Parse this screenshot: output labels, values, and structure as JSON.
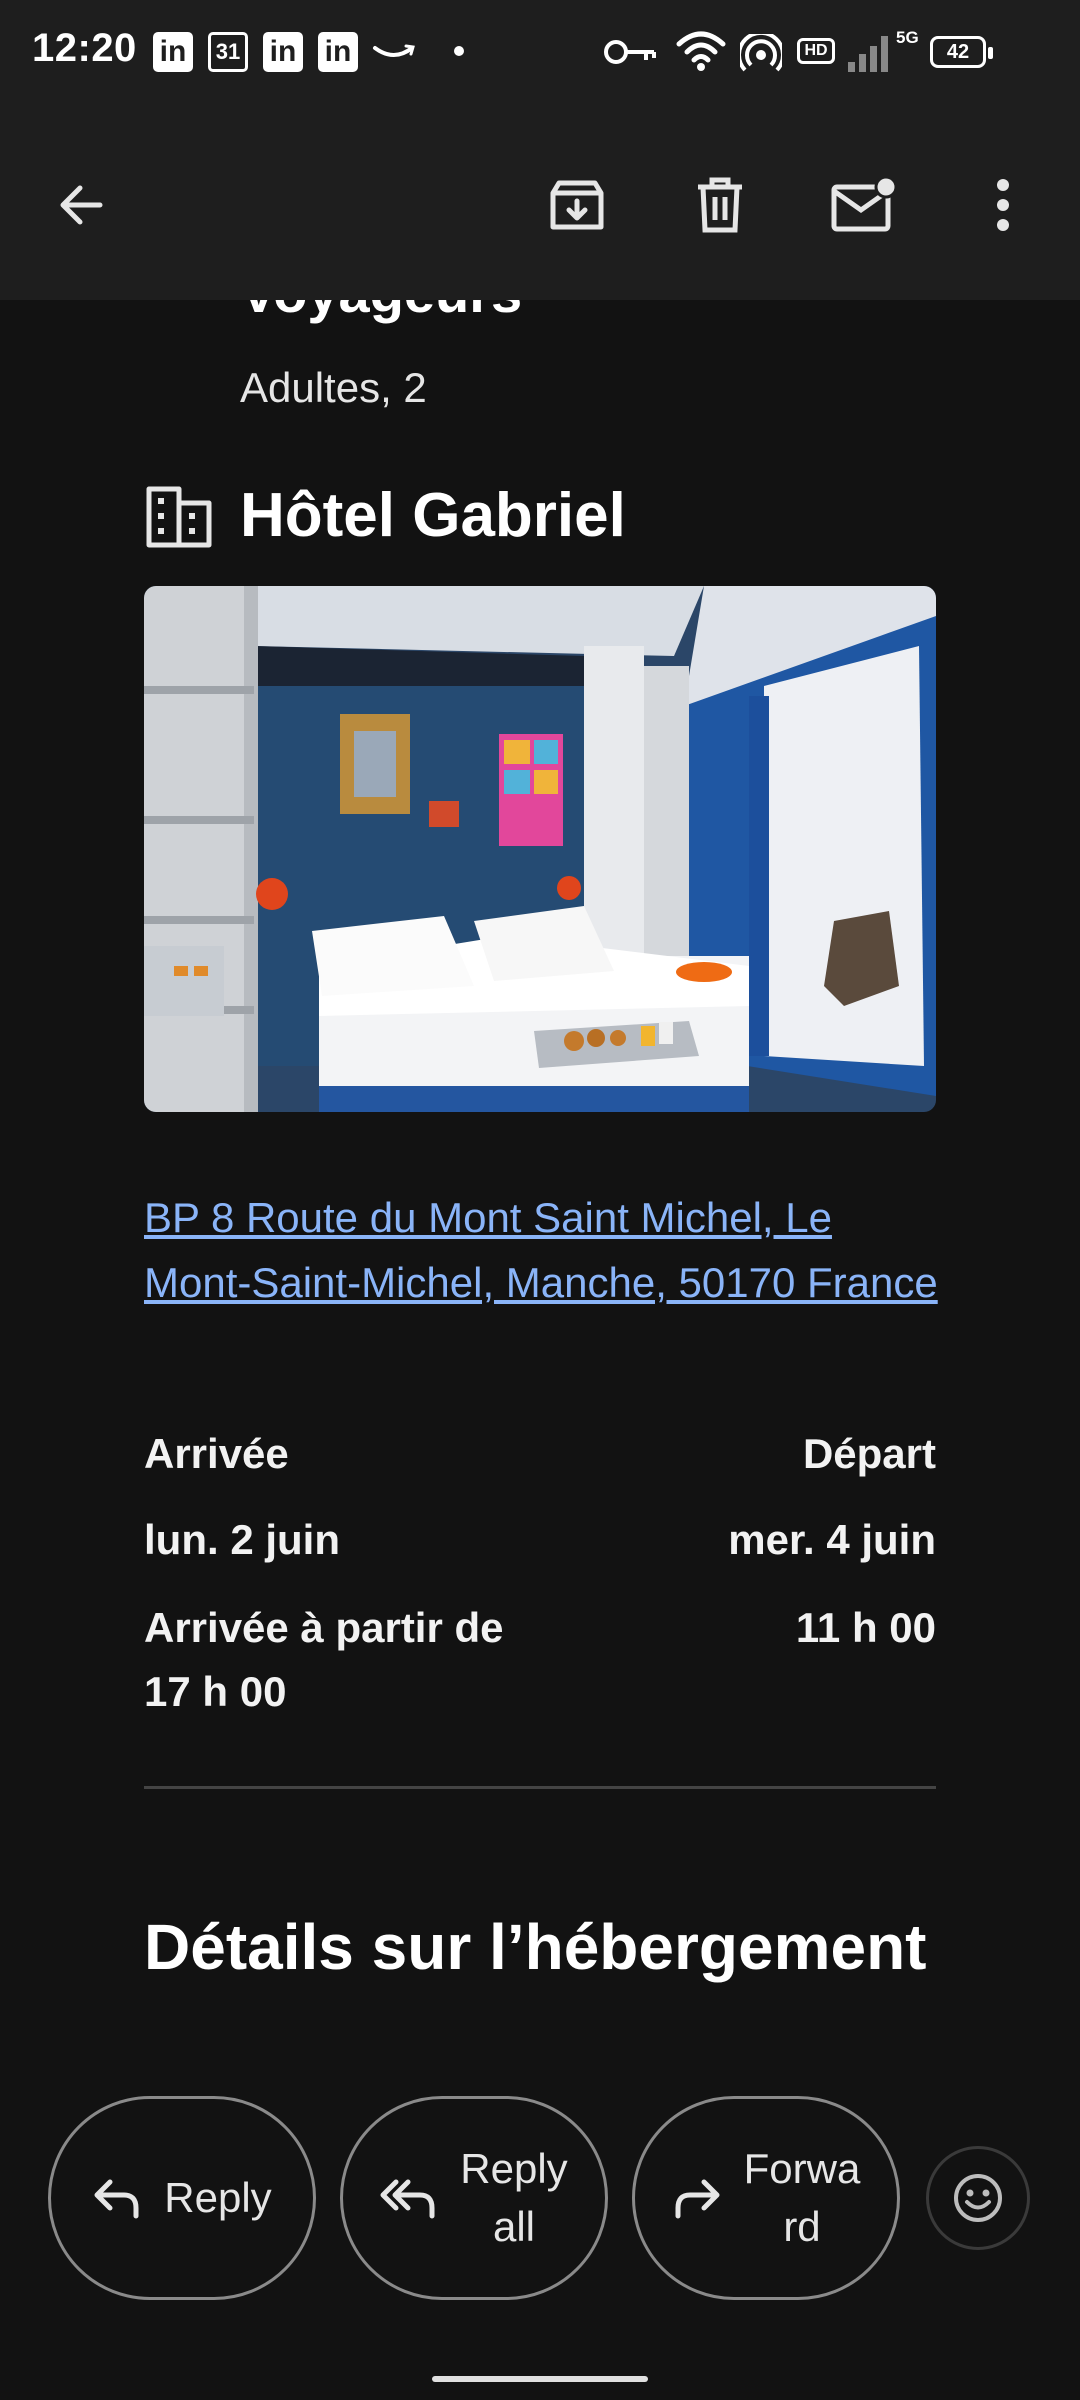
{
  "status_bar": {
    "time": "12:20",
    "linkedin_label": "in",
    "calendar_day": "31",
    "hd_label": "HD",
    "network_label": "5G",
    "battery": "42"
  },
  "email": {
    "travellers_title": "Voyageurs",
    "travellers_value": "Adultes, 2",
    "hotel_name": "Hôtel Gabriel",
    "address": "BP 8 Route du Mont Saint Michel, Le Mont-Saint-Michel, Manche, 50170 France",
    "arrival_label": "Arrivée",
    "departure_label": "Départ",
    "arrival_date": "lun. 2 juin",
    "departure_date": "mer. 4 juin",
    "arrival_time_line1": "Arrivée à partir de",
    "arrival_time_line2": "17 h 00",
    "departure_time": "11 h 00",
    "details_title": "Détails sur l’hébergement"
  },
  "actions": {
    "reply": "Reply",
    "reply_all_line1": "Reply",
    "reply_all_line2": "all",
    "forward_line1": "Forwa",
    "forward_line2": "rd"
  },
  "colors": {
    "background": "#121212",
    "bar": "#1e1e1e",
    "link": "#8ab4f8"
  }
}
